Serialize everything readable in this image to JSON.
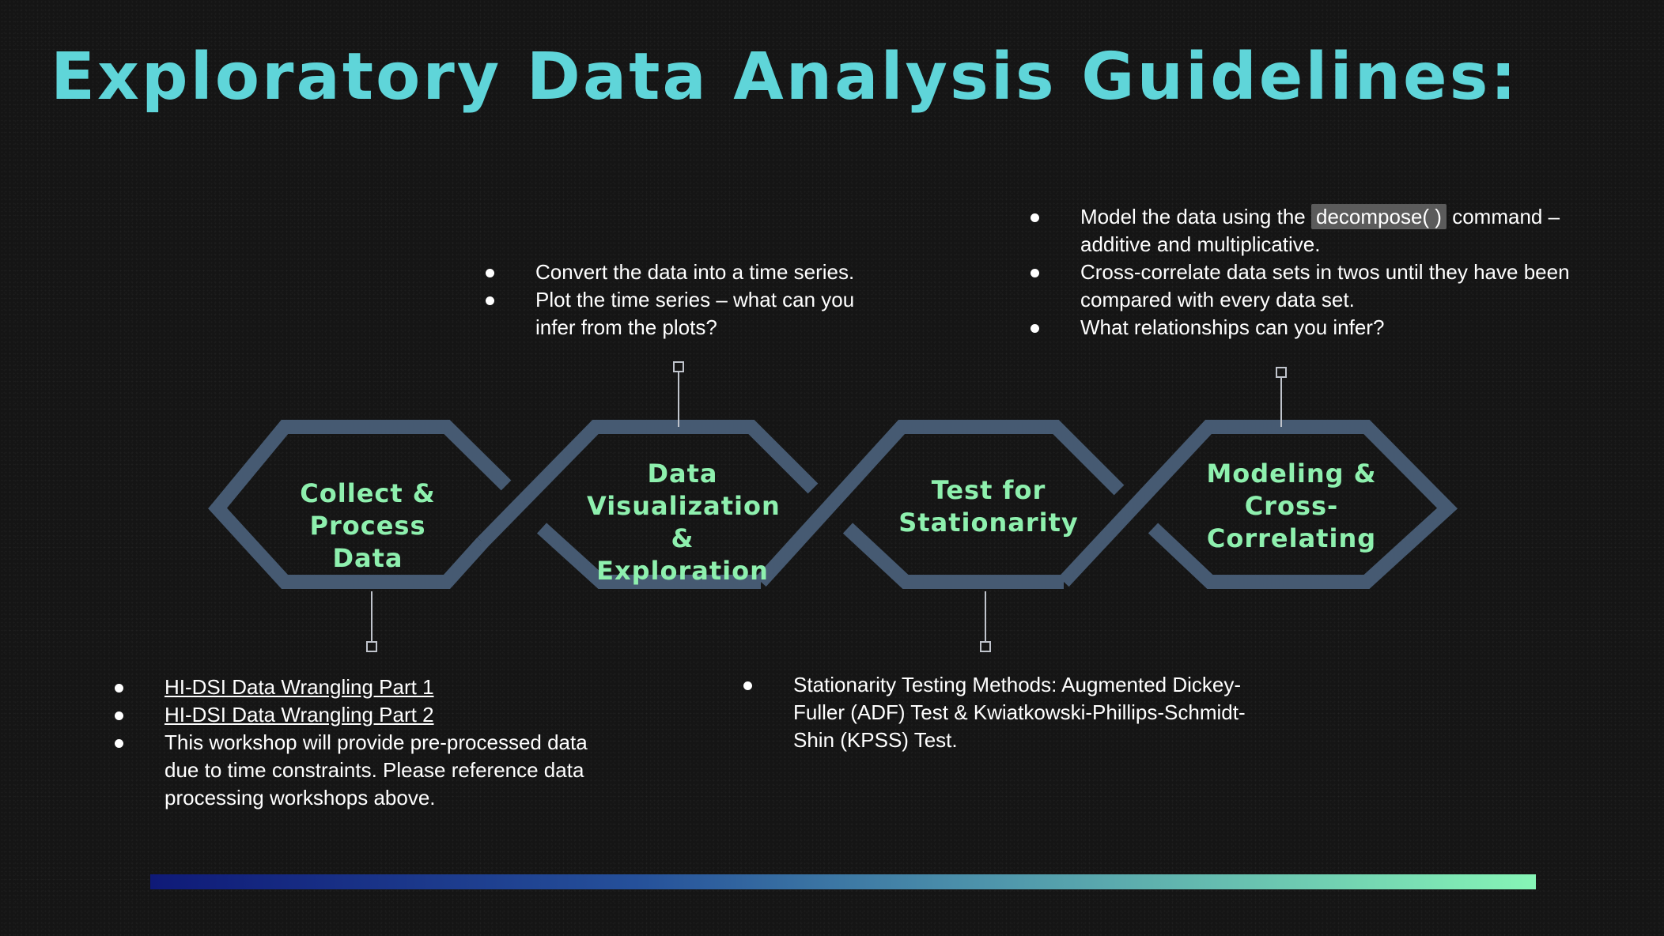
{
  "title": "Exploratory Data Analysis Guidelines:",
  "colors": {
    "title": "#5fd5d9",
    "stage_text": "#8ef0ae",
    "hexagon_stroke": "#465a72",
    "connector": "#c0c4cc",
    "gradient": [
      "#0f1a78",
      "#25509a",
      "#4d93ab",
      "#86f5b6"
    ]
  },
  "stages": [
    {
      "label_lines": [
        "Collect &",
        "Process Data"
      ]
    },
    {
      "label_lines": [
        "Data",
        "Visualization &",
        "Exploration"
      ]
    },
    {
      "label_lines": [
        "Test for",
        "Stationarity"
      ]
    },
    {
      "label_lines": [
        "Modeling &",
        "Cross-",
        "Correlating"
      ]
    }
  ],
  "notes": {
    "collect": [
      {
        "text": "HI-DSI Data Wrangling Part 1",
        "is_link": true
      },
      {
        "text": "HI-DSI Data Wrangling Part 2",
        "is_link": true
      },
      {
        "text": "This workshop will provide pre-processed data due to time constraints. Please reference data processing workshops above.",
        "is_link": false
      }
    ],
    "visualization": [
      {
        "text": "Convert the data into a time series."
      },
      {
        "text": "Plot the time series – what can you infer from the plots?"
      }
    ],
    "stationarity": [
      {
        "text": "Stationarity Testing Methods: Augmented Dickey-Fuller (ADF) Test & Kwiatkowski-Phillips-Schmidt-Shin (KPSS) Test."
      }
    ],
    "modeling": {
      "item1_before": "Model the data using the",
      "item1_code": "decompose( )",
      "item1_after": "command – additive and multiplicative.",
      "item2": "Cross-correlate data sets in twos until they have been compared with every data set.",
      "item3": "What relationships can you infer?"
    }
  }
}
